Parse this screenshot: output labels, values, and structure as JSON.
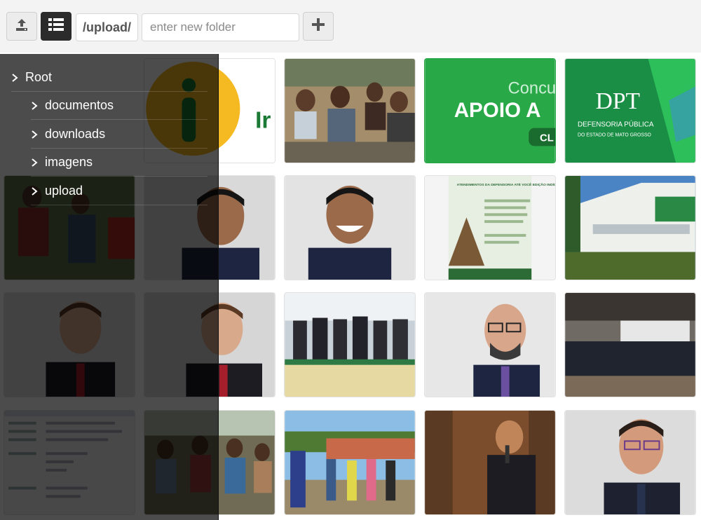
{
  "toolbar": {
    "upload_icon": "upload-icon",
    "list_icon": "list-view-icon",
    "current_path": "/upload/",
    "new_folder_placeholder": "enter new folder",
    "add_icon": "plus-icon"
  },
  "folder_tree": {
    "root_label": "Root",
    "items": [
      {
        "label": "documentos"
      },
      {
        "label": "downloads"
      },
      {
        "label": "imagens"
      },
      {
        "label": "upload"
      }
    ]
  },
  "thumbnails": [
    {
      "name": "info-logo-image",
      "text": "Ir"
    },
    {
      "name": "crowd-photo"
    },
    {
      "name": "banner-green",
      "line1": "Concu",
      "line2": "APOIO A",
      "button": "CL"
    },
    {
      "name": "defensoria-logo-image",
      "logo": "DPT",
      "line1": "DEFENSORIA PÚBLICA",
      "line2": "DO ESTADO DE MATO GROSSO"
    },
    {
      "name": "outdoor-group-photo"
    },
    {
      "name": "portrait-smiling-man-1"
    },
    {
      "name": "portrait-smiling-man-2"
    },
    {
      "name": "event-poster-image",
      "title": "ATENDIMENTOS DA DEFENSORIA ATÉ VOCÊ EDIÇÃO INDÍGENA"
    },
    {
      "name": "building-photo"
    },
    {
      "name": "portrait-man-red-tie-1"
    },
    {
      "name": "portrait-man-red-tie-2"
    },
    {
      "name": "meeting-table-photo"
    },
    {
      "name": "portrait-bald-man-glasses"
    },
    {
      "name": "auditorium-group-photo"
    },
    {
      "name": "document-screenshot"
    },
    {
      "name": "indigenous-community-photo"
    },
    {
      "name": "outdoor-meeting-photo"
    },
    {
      "name": "speaker-microphone-photo"
    },
    {
      "name": "portrait-man-glasses-suit"
    }
  ]
}
